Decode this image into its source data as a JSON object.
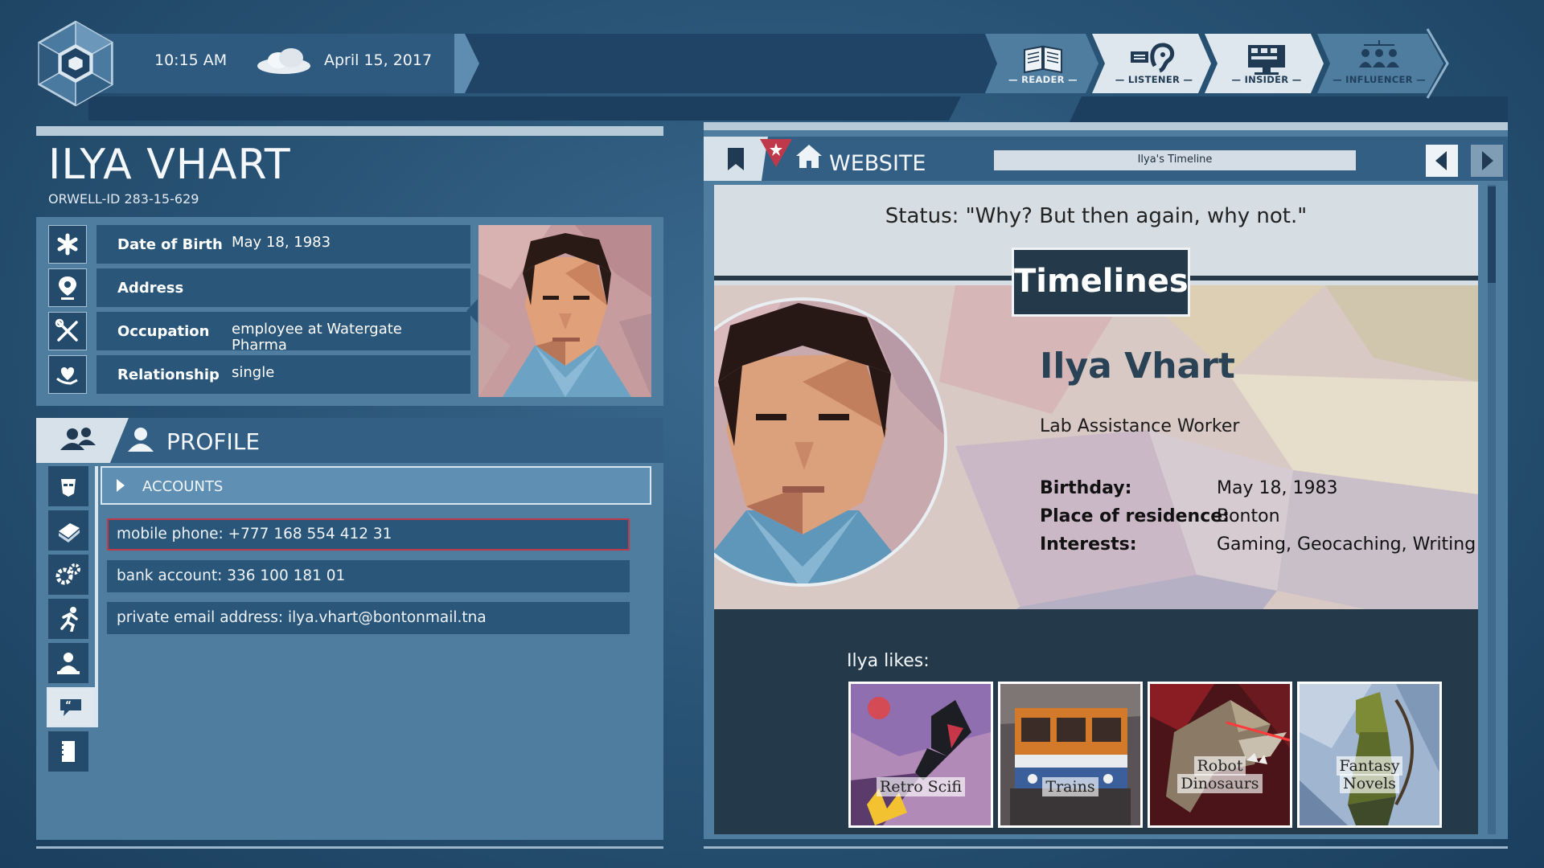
{
  "topbar": {
    "time": "10:15 AM",
    "date": "April 15, 2017",
    "weather_icon": "cloud-icon",
    "badges": [
      {
        "label": "— READER —",
        "icon": "book-icon",
        "active": true
      },
      {
        "label": "— LISTENER —",
        "icon": "ear-icon",
        "active": false
      },
      {
        "label": "— INSIDER —",
        "icon": "monitor-icon",
        "active": false
      },
      {
        "label": "— INFLUENCER —",
        "icon": "people-network-icon",
        "active": false
      }
    ]
  },
  "person": {
    "name": "ILYA VHART",
    "orwell_id": "ORWELL-ID  283-15-629",
    "fields": [
      {
        "key": "Date of Birth",
        "value": "May 18, 1983",
        "icon": "asterisk-icon"
      },
      {
        "key": "Address",
        "value": "",
        "icon": "location-pin-icon"
      },
      {
        "key": "Occupation",
        "value": "employee at Watergate Pharma",
        "icon": "tools-icon"
      },
      {
        "key": "Relationship",
        "value": "single",
        "icon": "heart-hand-icon"
      }
    ]
  },
  "profile": {
    "title": "PROFILE",
    "accounts_label": "ACCOUNTS",
    "side_icons": [
      "face-icon",
      "book-icon",
      "gears-icon",
      "running-icon",
      "person-desk-icon",
      "speech-bubble-icon",
      "document-icon"
    ],
    "entries": [
      "mobile phone: +777 168 554 412 31",
      "bank account: 336 100 181 01",
      "private email address: ilya.vhart@bontonmail.tna"
    ]
  },
  "website": {
    "label": "WEBSITE",
    "url": "Ilya's Timeline",
    "status": "Status: \"Why? But then again, why not.\"",
    "banner": "Timelines",
    "name": "Ilya Vhart",
    "job": "Lab Assistance Worker",
    "facts": [
      {
        "key": "Birthday:",
        "value": "May 18, 1983"
      },
      {
        "key": "Place of residence:",
        "value": "Bonton"
      },
      {
        "key": "Interests:",
        "value": "Gaming, Geocaching, Writing"
      }
    ],
    "likes_label": "Ilya likes:",
    "likes": [
      {
        "line1": "Retro Scifi",
        "line2": ""
      },
      {
        "line1": "Trains",
        "line2": ""
      },
      {
        "line1": "Robot",
        "line2": "Dinosaurs"
      },
      {
        "line1": "Fantasy",
        "line2": "Novels"
      }
    ]
  },
  "colors": {
    "panel": "#4f7da0",
    "row": "#2a5679",
    "dark": "#243a4b",
    "alert_red": "#c0394b"
  }
}
